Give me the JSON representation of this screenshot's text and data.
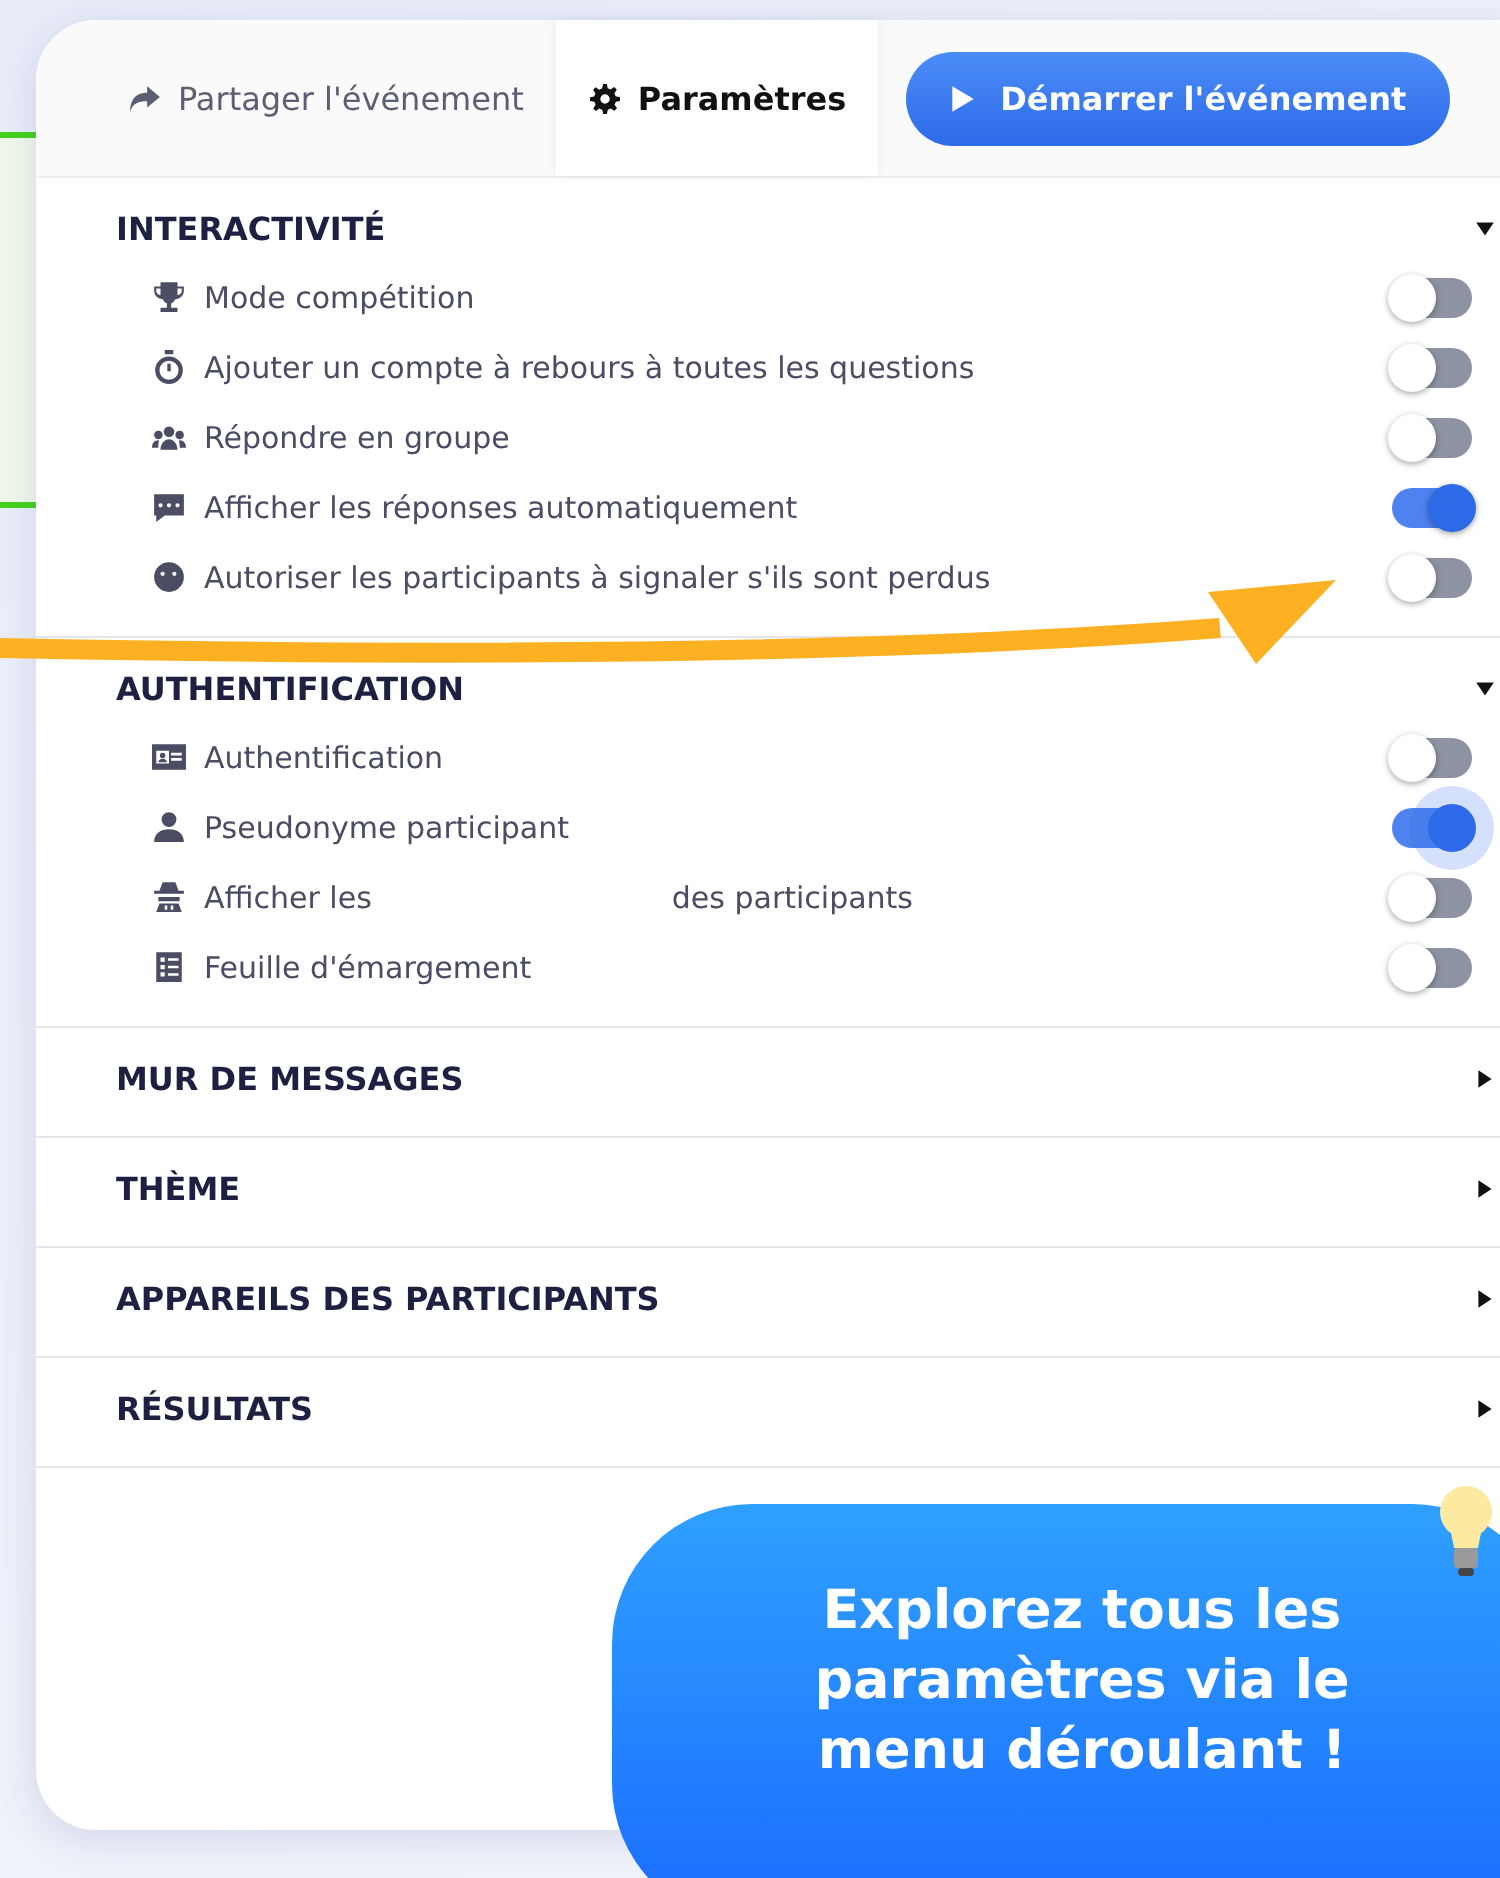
{
  "tabs": [
    {
      "label": "Partager l'événement",
      "selected": false
    },
    {
      "label": "Paramètres",
      "selected": true
    }
  ],
  "start_button": {
    "label": "Démarrer l'événement"
  },
  "sections": [
    {
      "title": "INTERACTIVITÉ",
      "expanded": true,
      "options": [
        {
          "label": "Mode compétition",
          "on": false
        },
        {
          "label": "Ajouter un compte à rebours à toutes les questions",
          "on": false
        },
        {
          "label": "Répondre en groupe",
          "on": false
        },
        {
          "label": "Afficher les réponses automatiquement",
          "on": true
        },
        {
          "label": "Autoriser les participants à signaler s'ils sont perdus",
          "on": false
        }
      ]
    },
    {
      "title": "AUTHENTIFICATION",
      "expanded": true,
      "options": [
        {
          "label": "Authentification",
          "on": false
        },
        {
          "label": "Pseudonyme participant",
          "on": true,
          "focused": true
        },
        {
          "label": "Afficher les",
          "label_end": "des participants",
          "on": false
        },
        {
          "label": "Feuille d'émargement",
          "on": false
        }
      ]
    },
    {
      "title": "MUR DE MESSAGES",
      "expanded": false
    },
    {
      "title": "THÈME",
      "expanded": false
    },
    {
      "title": "APPAREILS DES PARTICIPANTS",
      "expanded": false
    },
    {
      "title": "RÉSULTATS",
      "expanded": false
    }
  ],
  "callout": {
    "text": "Explorez tous les paramètres via le menu déroulant !"
  }
}
